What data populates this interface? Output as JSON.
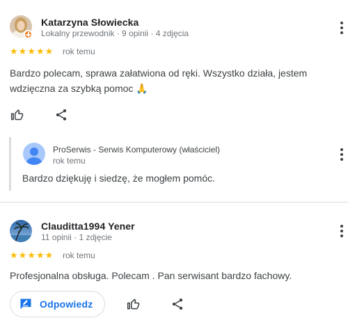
{
  "reviews": [
    {
      "author": "Katarzyna Słowiecka",
      "meta": "Lokalny przewodnik · 9 opinii · 4 zdjęcia",
      "rating": 5,
      "time": "rok temu",
      "text": "Bardzo polecam, sprawa załatwiona od ręki. Wszystko działa, jestem wdzięczna za szybką pomoc 🙏",
      "owner_reply": {
        "author": "ProSerwis - Serwis Komputerowy (właściciel)",
        "time": "rok temu",
        "text": "Bardzo dziękuję i siedzę, że mogłem pomóc."
      }
    },
    {
      "author": "Clauditta1994 Yener",
      "meta": "11 opinii · 1 zdjęcie",
      "rating": 5,
      "time": "rok temu",
      "text": "Profesjonalna obsługa. Polecam . Pan serwisant bardzo fachowy."
    }
  ],
  "actions": {
    "reply_label": "Odpowiedz"
  },
  "colors": {
    "star": "#fbbc04",
    "accent": "#1a73e8",
    "guide_badge": "#e8710a"
  },
  "icons": [
    "thumb-up-icon",
    "share-icon",
    "more-vert-icon",
    "reply-icon",
    "person-icon"
  ]
}
